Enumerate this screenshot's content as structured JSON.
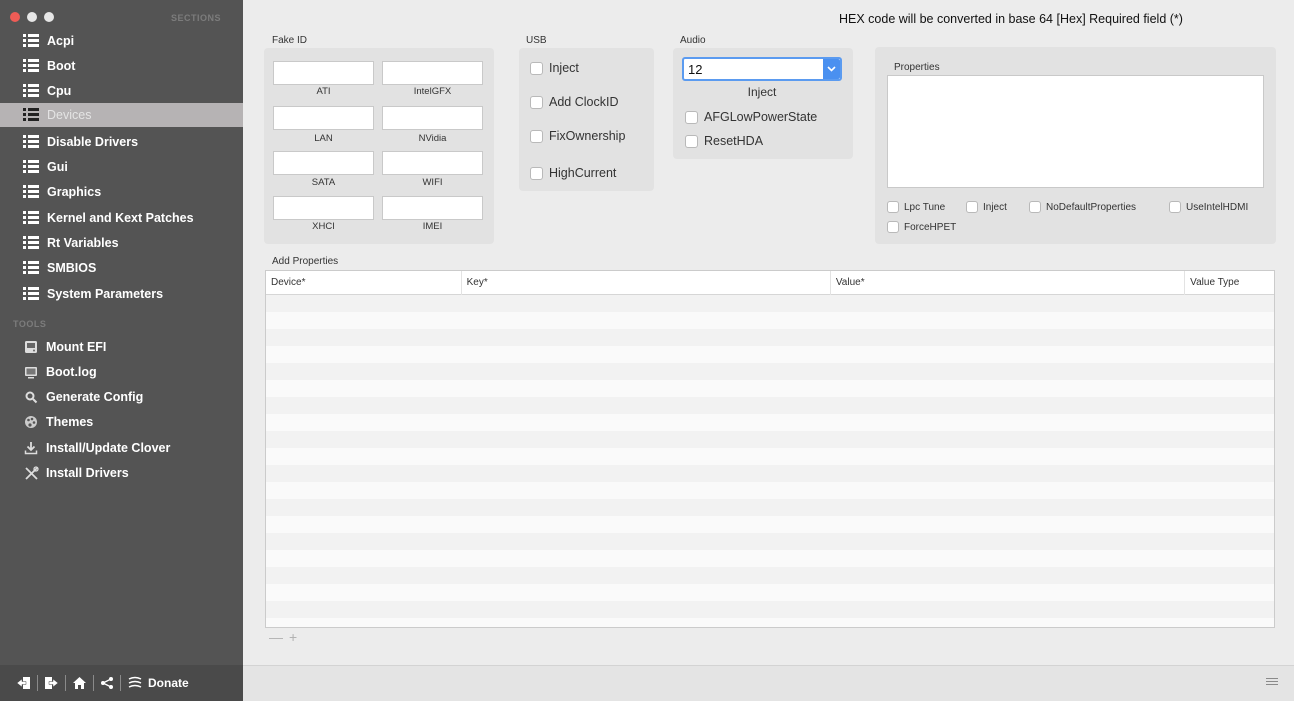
{
  "window": {
    "title": ""
  },
  "sidebar": {
    "sections_label": "SECTIONS",
    "items": [
      {
        "label": "Acpi"
      },
      {
        "label": "Boot"
      },
      {
        "label": "Cpu"
      },
      {
        "label": "Devices"
      },
      {
        "label": "Disable Drivers"
      },
      {
        "label": "Gui"
      },
      {
        "label": "Graphics"
      },
      {
        "label": "Kernel and Kext Patches"
      },
      {
        "label": "Rt Variables"
      },
      {
        "label": "SMBIOS"
      },
      {
        "label": "System Parameters"
      }
    ],
    "selected_item": "Devices",
    "tools_label": "TOOLS",
    "tools": [
      {
        "label": "Mount EFI",
        "icon": "disk-icon"
      },
      {
        "label": "Boot.log",
        "icon": "log-icon"
      },
      {
        "label": "Generate Config",
        "icon": "generate-icon"
      },
      {
        "label": "Themes",
        "icon": "themes-icon"
      },
      {
        "label": "Install/Update Clover",
        "icon": "download-icon"
      },
      {
        "label": "Install Drivers",
        "icon": "tools-icon"
      }
    ],
    "bottom": {
      "donate_label": "Donate"
    }
  },
  "header": {
    "hex_note": "HEX code will be converted in base 64 [Hex]   Required field (*)"
  },
  "fake_id": {
    "label": "Fake ID",
    "fields": [
      {
        "label": "ATI",
        "value": ""
      },
      {
        "label": "IntelGFX",
        "value": ""
      },
      {
        "label": "LAN",
        "value": ""
      },
      {
        "label": "NVidia",
        "value": ""
      },
      {
        "label": "SATA",
        "value": ""
      },
      {
        "label": "WIFI",
        "value": ""
      },
      {
        "label": "XHCI",
        "value": ""
      },
      {
        "label": "IMEI",
        "value": ""
      }
    ]
  },
  "usb": {
    "label": "USB",
    "checkboxes": [
      {
        "label": "Inject",
        "checked": false
      },
      {
        "label": "Add ClockID",
        "checked": false
      },
      {
        "label": "FixOwnership",
        "checked": false
      },
      {
        "label": "HighCurrent",
        "checked": false
      }
    ]
  },
  "audio": {
    "label": "Audio",
    "inject_value": "12",
    "inject_label": "Inject",
    "checkboxes": [
      {
        "label": "AFGLowPowerState",
        "checked": false
      },
      {
        "label": "ResetHDA",
        "checked": false
      }
    ]
  },
  "properties": {
    "label": "Properties",
    "value": "",
    "checkboxes": [
      {
        "label": "Lpc Tune",
        "checked": false
      },
      {
        "label": "Inject",
        "checked": false
      },
      {
        "label": "NoDefaultProperties",
        "checked": false
      },
      {
        "label": "UseIntelHDMI",
        "checked": false
      },
      {
        "label": "ForceHPET",
        "checked": false
      }
    ]
  },
  "add_properties": {
    "label": "Add Properties",
    "columns": [
      "Device*",
      "Key*",
      "Value*",
      "Value Type"
    ],
    "rows": [],
    "minus_label": "—",
    "plus_label": "+"
  },
  "colors": {
    "sidebar_bg": "#545454",
    "sidebar_selected": "#b6b3b4",
    "accent": "#4a90f0",
    "close_button": "#ee5c56"
  }
}
